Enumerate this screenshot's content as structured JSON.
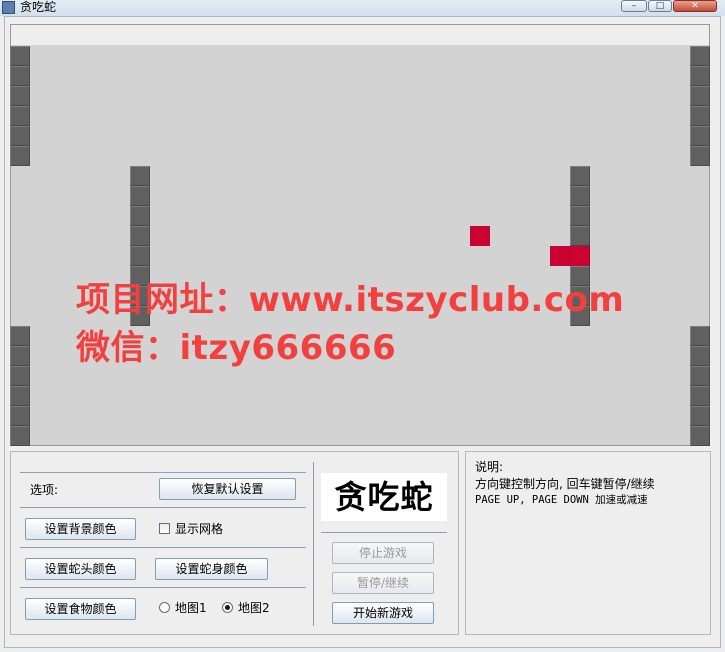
{
  "window": {
    "title": "贪吃蛇",
    "minimize_glyph": "–",
    "maximize_glyph": "□",
    "close_glyph": "✕",
    "app_icon": "java-icon"
  },
  "board": {
    "background": "#d3d3d3",
    "wall_color": "#606060",
    "snake_color": "#cc0033",
    "food_color": "#cc0033"
  },
  "watermark": {
    "line1": "项目网址：www.itszyclub.com",
    "line2": "微信：itzy666666",
    "color": "#f23f3f"
  },
  "controls": {
    "options_label": "选项:",
    "reset_defaults": "恢复默认设置",
    "set_background_color": "设置背景颜色",
    "show_grid": "显示网格",
    "show_grid_checked": false,
    "set_head_color": "设置蛇头颜色",
    "set_body_color": "设置蛇身颜色",
    "set_food_color": "设置食物颜色",
    "map1": "地图1",
    "map2": "地图2",
    "selected_map": "地图2"
  },
  "game": {
    "logo": "贪吃蛇",
    "stop_game": "停止游戏",
    "pause_resume": "暂停/继续",
    "new_game": "开始新游戏"
  },
  "help": {
    "title": "说明:",
    "line1": "方向键控制方向, 回车键暂停/继续",
    "line2": "PAGE UP, PAGE DOWN 加速或减速"
  }
}
